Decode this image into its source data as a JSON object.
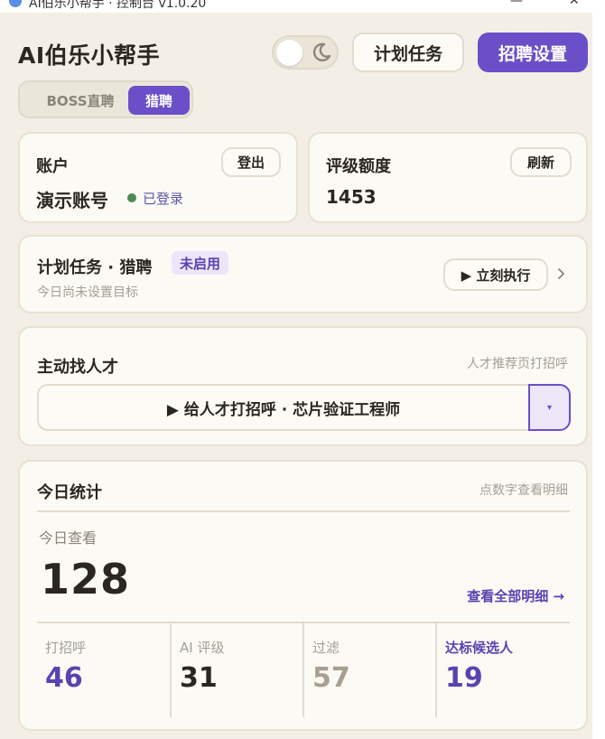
{
  "window": {
    "title": "AI伯乐小帮手 · 控制台 v1.0.20",
    "minimize": "—",
    "close": "✕"
  },
  "header": {
    "title": "AI伯乐小帮手",
    "schedule_label": "计划任务",
    "settings_label": "招聘设置"
  },
  "platforms": [
    "BOSS直聘",
    "猎聘"
  ],
  "account": {
    "label": "账户",
    "logout_label": "登出",
    "name": "演示账号",
    "status": "已登录"
  },
  "quota": {
    "label": "评级额度",
    "refresh_label": "刷新",
    "value": "1453"
  },
  "schedule_card": {
    "title": "计划任务 · 猎聘",
    "badge": "未启用",
    "subtitle": "今日尚未设置目标",
    "run_label": "▶ 立刻执行"
  },
  "talent": {
    "title": "主动找人才",
    "hint": "人才推荐页打招呼",
    "greet_label": "▶ 给人才打招呼 · 芯片验证工程师",
    "dropdown_icon": "▾"
  },
  "stats": {
    "title": "今日统计",
    "hint": "点数字查看明细",
    "today_view_label": "今日查看",
    "today_view_value": "128",
    "detail_link": "查看全部明细 →",
    "metrics": [
      {
        "label": "打招呼",
        "value": "46",
        "color": "#5a42b0"
      },
      {
        "label": "AI 评级",
        "value": "31",
        "color": "#2b2620"
      },
      {
        "label": "过滤",
        "value": "57",
        "color": "#a79f8f"
      },
      {
        "label": "达标候选人",
        "value": "19",
        "color": "#5a42b0"
      }
    ]
  },
  "colors": {
    "accent": "#6a4fc8",
    "background": "#f3efe6",
    "card": "#fcfaf5",
    "online": "#4f8a55"
  }
}
